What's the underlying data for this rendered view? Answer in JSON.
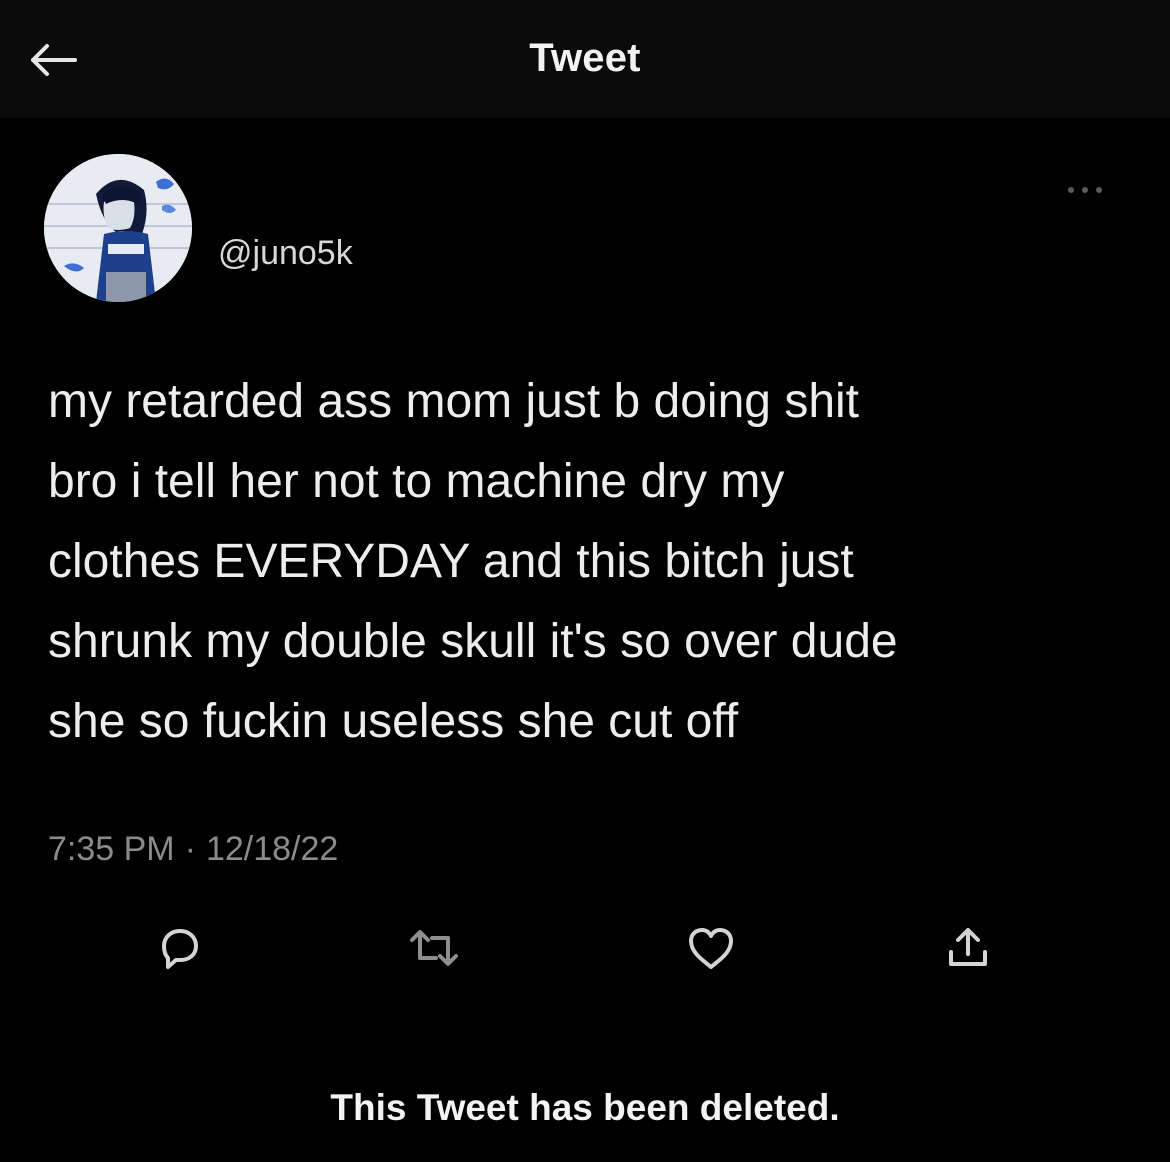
{
  "header": {
    "title": "Tweet",
    "back_icon": "arrow-left-icon"
  },
  "author": {
    "handle": "@juno5k",
    "avatar_icon": "avatar-image"
  },
  "more_icon": "ellipsis-icon",
  "tweet": {
    "text": "my retarded ass mom just b doing shit\nbro i tell her not to machine dry my\nclothes EVERYDAY and this bitch just\nshrunk my double skull it's so over dude\nshe so fuckin useless she cut off",
    "time": "7:35 PM",
    "separator": "·",
    "date": "12/18/22"
  },
  "actions": [
    {
      "icon": "reply-icon"
    },
    {
      "icon": "retweet-icon"
    },
    {
      "icon": "heart-icon"
    },
    {
      "icon": "share-icon"
    }
  ],
  "footer": {
    "deleted_notice": "This Tweet has been deleted."
  },
  "colors": {
    "background": "#000000",
    "header_background": "#0b0b0b",
    "text": "#ededed",
    "muted": "#8b8b8b"
  }
}
